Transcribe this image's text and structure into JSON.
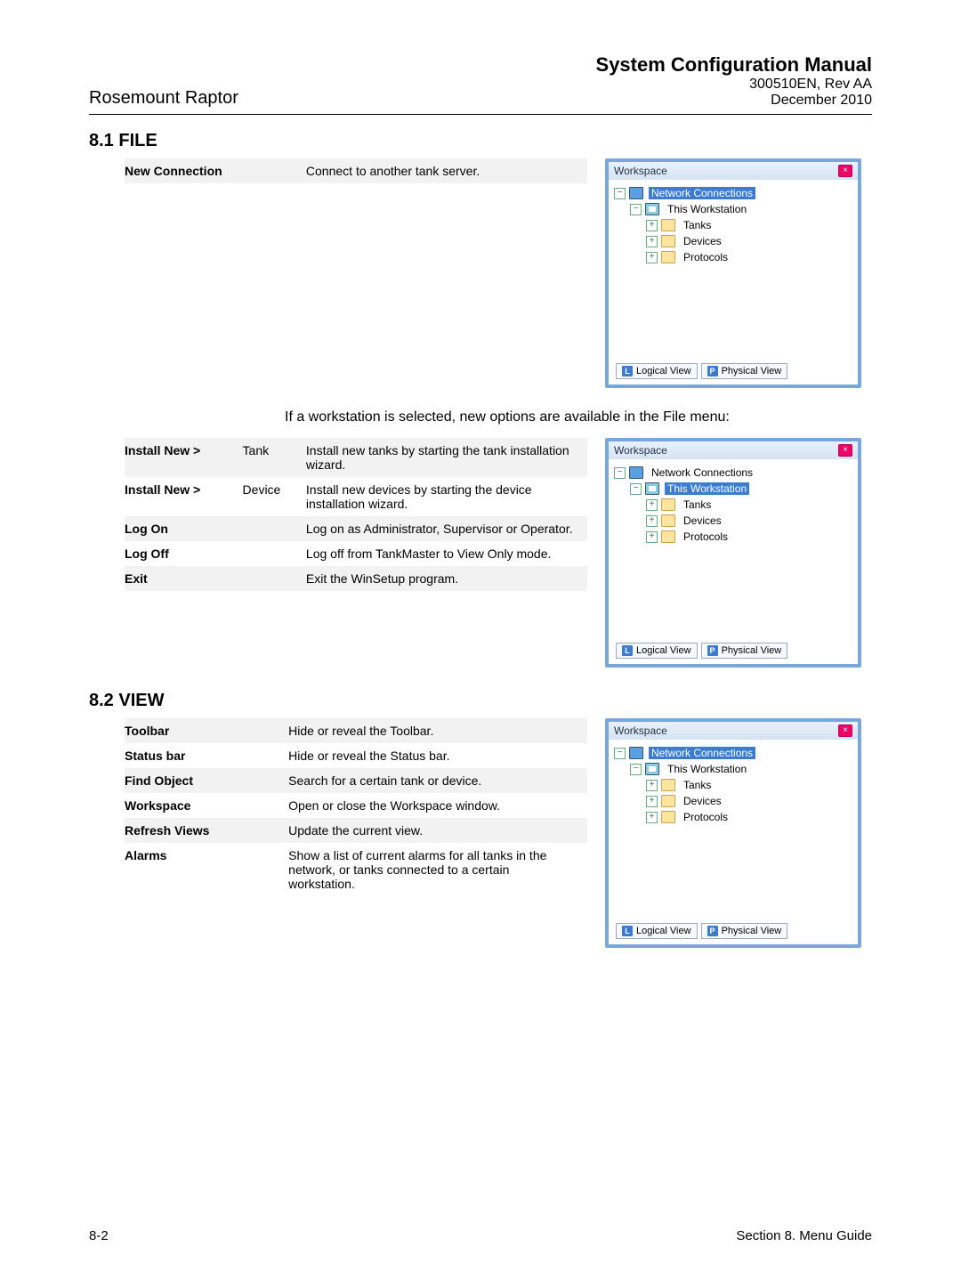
{
  "header": {
    "product": "Rosemount Raptor",
    "doc_title": "System Configuration Manual",
    "doc_rev": "300510EN, Rev AA",
    "doc_date": "December 2010"
  },
  "section_file": {
    "heading": "8.1   FILE",
    "rows1": [
      {
        "term": "New Connection",
        "sub": "",
        "desc": "Connect to another tank server."
      }
    ],
    "midtext": "If a workstation is selected, new options are available in the File menu:",
    "rows2": [
      {
        "term": "Install New >",
        "sub": "Tank",
        "desc": "Install new tanks by starting the tank installation wizard."
      },
      {
        "term": "Install New >",
        "sub": "Device",
        "desc": "Install new devices by starting the device installation wizard."
      },
      {
        "term": "Log On",
        "sub": "",
        "desc": "Log on as Administrator, Supervisor or Operator."
      },
      {
        "term": "Log Off",
        "sub": "",
        "desc": "Log off from TankMaster to View Only mode."
      },
      {
        "term": "Exit",
        "sub": "",
        "desc": "Exit the WinSetup program."
      }
    ]
  },
  "section_view": {
    "heading": "8.2   VIEW",
    "rows": [
      {
        "term": "Toolbar",
        "desc": "Hide or reveal the Toolbar."
      },
      {
        "term": "Status bar",
        "desc": "Hide or reveal the Status bar."
      },
      {
        "term": "Find Object",
        "desc": "Search for a certain tank or device."
      },
      {
        "term": "Workspace",
        "desc": "Open or close the Workspace window."
      },
      {
        "term": "Refresh Views",
        "desc": "Update the current view."
      },
      {
        "term": "Alarms",
        "desc": "Show a list of current alarms for all tanks in the network, or tanks connected to a certain workstation."
      }
    ]
  },
  "workspace": {
    "title": "Workspace",
    "close": "×",
    "tabs": {
      "logical": "Logical View",
      "physical": "Physical View",
      "badgeL": "L",
      "badgeP": "P"
    },
    "tree": {
      "root": "Network Connections",
      "child": "This Workstation",
      "leaves": [
        "Tanks",
        "Devices",
        "Protocols"
      ]
    },
    "variants": [
      {
        "selected": "root"
      },
      {
        "selected": "child"
      },
      {
        "selected": "root"
      }
    ]
  },
  "footer": {
    "page": "8-2",
    "section": "Section 8. Menu Guide"
  }
}
